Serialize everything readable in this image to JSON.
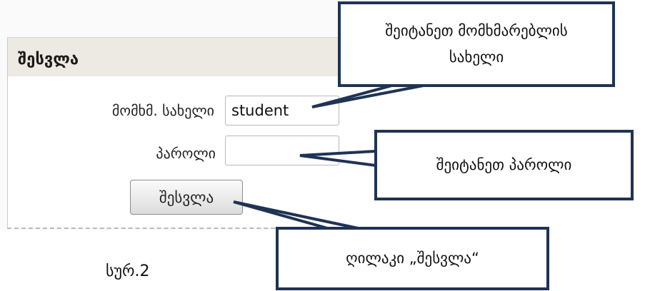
{
  "login_panel": {
    "title": "შესვლა",
    "username_label": "მომხმ. სახელი",
    "username_value": "student",
    "password_label": "პაროლი",
    "password_value": "",
    "login_button_label": "შესვლა"
  },
  "callouts": {
    "username_line1": "შეიტანეთ მომხმარებლის",
    "username_line2": "სახელი",
    "password": "შეიტანეთ პაროლი",
    "button": "ღილაკი „შესვლა“"
  },
  "caption": "სურ.2",
  "colors": {
    "callout_border": "#1f3352",
    "panel_header_bg": "#ede9e3"
  }
}
